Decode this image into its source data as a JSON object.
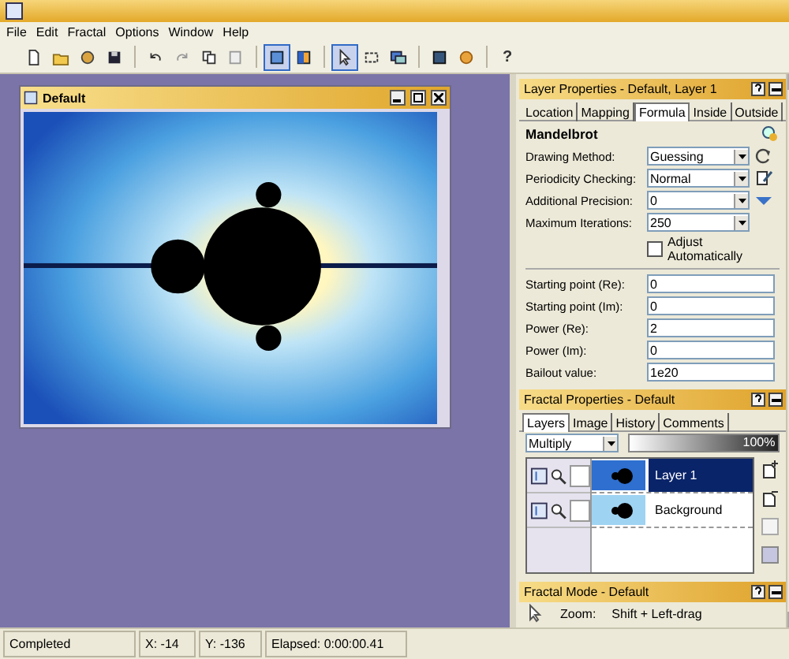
{
  "menu": [
    "File",
    "Edit",
    "Fractal",
    "Options",
    "Window",
    "Help"
  ],
  "toolbar_help": "?",
  "document": {
    "title": "Default"
  },
  "layer_properties": {
    "title": "Layer Properties - Default, Layer 1",
    "tabs": [
      {
        "label": "Location",
        "selected": false
      },
      {
        "label": "Mapping",
        "selected": false
      },
      {
        "label": "Formula",
        "selected": true
      },
      {
        "label": "Inside",
        "selected": false
      },
      {
        "label": "Outside",
        "selected": false
      }
    ],
    "formula_name": "Mandelbrot",
    "options": [
      {
        "label": "Drawing Method:",
        "value": "Guessing"
      },
      {
        "label": "Periodicity Checking:",
        "value": "Normal"
      },
      {
        "label": "Additional Precision:",
        "value": "0"
      },
      {
        "label": "Maximum Iterations:",
        "value": "250"
      }
    ],
    "adjust": {
      "label": "Adjust Automatically",
      "checked": false
    },
    "parameters": [
      {
        "label": "Starting point (Re):",
        "value": "0"
      },
      {
        "label": "Starting point (Im):",
        "value": "0"
      },
      {
        "label": "Power (Re):",
        "value": "2"
      },
      {
        "label": "Power (Im):",
        "value": "0"
      },
      {
        "label": "Bailout value:",
        "value": "1e20"
      }
    ]
  },
  "fractal_properties": {
    "title": "Fractal Properties - Default",
    "tabs": [
      {
        "label": "Layers",
        "selected": true
      },
      {
        "label": "Image",
        "selected": false
      },
      {
        "label": "History",
        "selected": false
      },
      {
        "label": "Comments",
        "selected": false
      }
    ],
    "blend_mode": "Multiply",
    "opacity": {
      "level": 1,
      "reading": "100%"
    },
    "layers": [
      {
        "name": "Layer 1",
        "selected": true
      },
      {
        "name": "Background",
        "selected": false
      }
    ]
  },
  "fractal_mode": {
    "title": "Fractal Mode - Default",
    "zoom_label": "Zoom:",
    "zoom_hint": "Shift + Left-drag"
  },
  "status_bar": [
    "Completed",
    "X: -14",
    "Y: -136",
    "Elapsed: 0:00:00.41"
  ]
}
